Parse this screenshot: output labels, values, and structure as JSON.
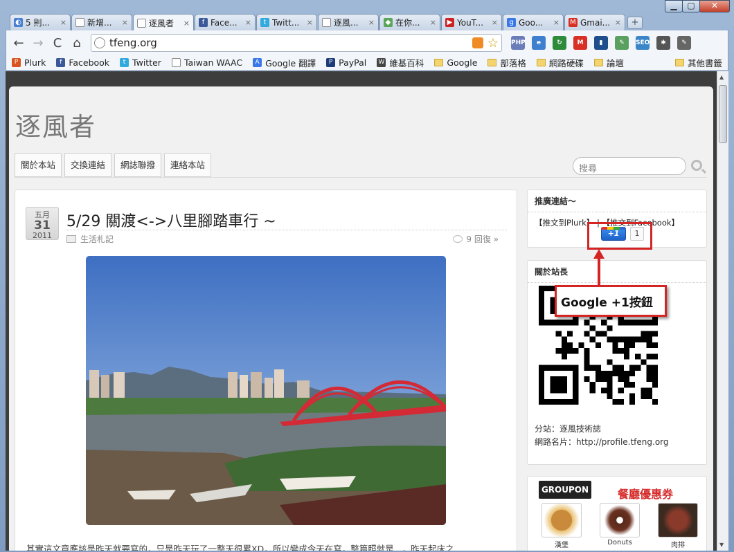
{
  "window": {
    "minimize": "▁",
    "maximize": "▢",
    "close": "✕"
  },
  "tabs": [
    {
      "label": "5 則...",
      "icon": "plurk-icon",
      "color": "#4a7fd1",
      "glyph": "◐"
    },
    {
      "label": "新增...",
      "icon": "page-icon",
      "color": "#ffffff",
      "glyph": ""
    },
    {
      "label": "逐風者",
      "icon": "page-icon",
      "color": "#ffffff",
      "glyph": "",
      "active": true
    },
    {
      "label": "Face...",
      "icon": "facebook-icon",
      "color": "#3b5998",
      "glyph": "f"
    },
    {
      "label": "Twitt...",
      "icon": "twitter-icon",
      "color": "#33aadd",
      "glyph": "t"
    },
    {
      "label": "逐風...",
      "icon": "page-icon",
      "color": "#ffffff",
      "glyph": ""
    },
    {
      "label": "在你...",
      "icon": "maps-icon",
      "color": "#5aa55a",
      "glyph": "◆"
    },
    {
      "label": "YouT...",
      "icon": "youtube-icon",
      "color": "#cc2222",
      "glyph": "▶"
    },
    {
      "label": "Goo...",
      "icon": "google-icon",
      "color": "#3b78e7",
      "glyph": "g"
    },
    {
      "label": "Gmai...",
      "icon": "gmail-icon",
      "color": "#d93025",
      "glyph": "M"
    }
  ],
  "tab_close": "×",
  "new_tab": "+",
  "nav": {
    "back": "←",
    "forward": "→",
    "reload": "C",
    "home": "⌂"
  },
  "address": {
    "url": "tfeng.org"
  },
  "star": "☆",
  "extensions": [
    {
      "name": "php-extension-icon",
      "color": "#6a7db8",
      "label": "PHP"
    },
    {
      "name": "ie-tab-icon",
      "color": "#3f7fd0",
      "label": "e"
    },
    {
      "name": "green-extension-icon",
      "color": "#2e8b3a",
      "label": "↻"
    },
    {
      "name": "gmail-checker-icon",
      "color": "#d93025",
      "label": "M"
    },
    {
      "name": "stats-extension-icon",
      "color": "#1f4e8c",
      "label": "▮"
    },
    {
      "name": "clip-extension-icon",
      "color": "#5aa060",
      "label": "✎"
    },
    {
      "name": "seo-extension-icon",
      "color": "#3a86c8",
      "label": "SEO"
    },
    {
      "name": "bug-extension-icon",
      "color": "#555555",
      "label": "✱"
    },
    {
      "name": "wrench-menu-icon",
      "color": "#666666",
      "label": "✎"
    }
  ],
  "bookmarks": [
    {
      "label": "Plurk",
      "icon": "plurk-icon",
      "color": "#d9541e",
      "glyph": "P"
    },
    {
      "label": "Facebook",
      "icon": "facebook-icon",
      "color": "#3b5998",
      "glyph": "f"
    },
    {
      "label": "Twitter",
      "icon": "twitter-icon",
      "color": "#33aadd",
      "glyph": "t"
    },
    {
      "label": "Taiwan WAAC",
      "icon": "page-icon",
      "color": "#ffffff",
      "glyph": ""
    },
    {
      "label": "Google 翻譯",
      "icon": "translate-icon",
      "color": "#3b78e7",
      "glyph": "A"
    },
    {
      "label": "PayPal",
      "icon": "paypal-icon",
      "color": "#1d3c78",
      "glyph": "P"
    },
    {
      "label": "維基百科",
      "icon": "wikipedia-icon",
      "color": "#444444",
      "glyph": "W"
    },
    {
      "label": "Google",
      "icon": "folder-icon",
      "folder": true
    },
    {
      "label": "部落格",
      "icon": "folder-icon",
      "folder": true
    },
    {
      "label": "網路硬碟",
      "icon": "folder-icon",
      "folder": true
    },
    {
      "label": "論壇",
      "icon": "folder-icon",
      "folder": true
    }
  ],
  "other_bookmarks": "其他書籤",
  "site": {
    "title": "逐風者",
    "menu": [
      "關於本站",
      "交換連結",
      "網誌聯撥",
      "連絡本站"
    ],
    "search_placeholder": "搜尋"
  },
  "post": {
    "date_month": "五月",
    "date_day": "31",
    "date_year": "2011",
    "title": "5/29 關渡<->八里腳踏車行 ~",
    "category": "生活札記",
    "replies": "9 回復 »",
    "excerpt": "其實這文章應該是昨天就要寫的，只是昨天玩了一整天很累XD，所以變成今天在寫，整篇照就是...，昨天起床之"
  },
  "sidebar": {
    "promo_title": "推廣連結～",
    "promo_links": "【推文到Plurk】 | 【推文到Facebook】",
    "plusone_label": "+1",
    "plusone_count": "1",
    "about_title": "關於站長",
    "about_line1": "分站：逐風技術誌",
    "about_line2": "網路名片：http://profile.tfeng.org",
    "groupon_logo": "GROUPON",
    "coupon_title": "餐廳優惠券",
    "foods": [
      "漢堡",
      "Donuts",
      "肉排"
    ]
  },
  "annotation": {
    "callout": "Google +1按鈕",
    "color": "#d42424"
  }
}
